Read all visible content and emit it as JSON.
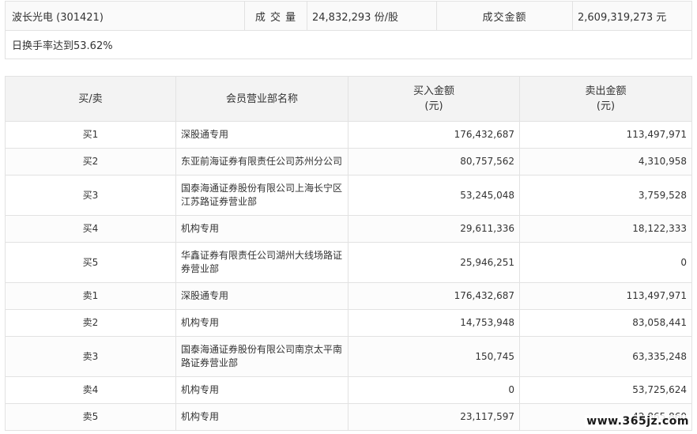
{
  "summary": {
    "stock": "波长光电 (301421)",
    "volume_label": "成 交 量",
    "volume_value": "24,832,293 份/股",
    "amount_label": "成交金额",
    "amount_value": "2,609,319,273 元",
    "turnover": "日换手率达到53.62%"
  },
  "table": {
    "headers": {
      "side": "买/卖",
      "dept": "会员营业部名称",
      "buy": "买入金额",
      "buy_unit": "(元)",
      "sell": "卖出金额",
      "sell_unit": "(元)"
    },
    "rows": [
      {
        "side": "买1",
        "dept_1": "深股通专用",
        "dept_2": "",
        "buy": "176,432,687",
        "sell": "113,497,971"
      },
      {
        "side": "买2",
        "dept_1": "东亚前海证券有限责任公司苏州分公司",
        "dept_2": "",
        "buy": "80,757,562",
        "sell": "4,310,958"
      },
      {
        "side": "买3",
        "dept_1": "国泰海通证券股份有限公司上海长宁区",
        "dept_2": "江苏路证券营业部",
        "buy": "53,245,048",
        "sell": "3,759,528"
      },
      {
        "side": "买4",
        "dept_1": "机构专用",
        "dept_2": "",
        "buy": "29,611,336",
        "sell": "18,122,333"
      },
      {
        "side": "买5",
        "dept_1": "华鑫证券有限责任公司湖州大线场路证",
        "dept_2": "券营业部",
        "buy": "25,946,251",
        "sell": "0"
      },
      {
        "side": "卖1",
        "dept_1": "深股通专用",
        "dept_2": "",
        "buy": "176,432,687",
        "sell": "113,497,971"
      },
      {
        "side": "卖2",
        "dept_1": "机构专用",
        "dept_2": "",
        "buy": "14,753,948",
        "sell": "83,058,441"
      },
      {
        "side": "卖3",
        "dept_1": "国泰海通证券股份有限公司南京太平南",
        "dept_2": "路证券营业部",
        "buy": "150,745",
        "sell": "63,335,248"
      },
      {
        "side": "卖4",
        "dept_1": "机构专用",
        "dept_2": "",
        "buy": "0",
        "sell": "53,725,624"
      },
      {
        "side": "卖5",
        "dept_1": "机构专用",
        "dept_2": "",
        "buy": "23,117,597",
        "sell": "42,865,860"
      }
    ]
  },
  "watermark": "www.365jz.com"
}
